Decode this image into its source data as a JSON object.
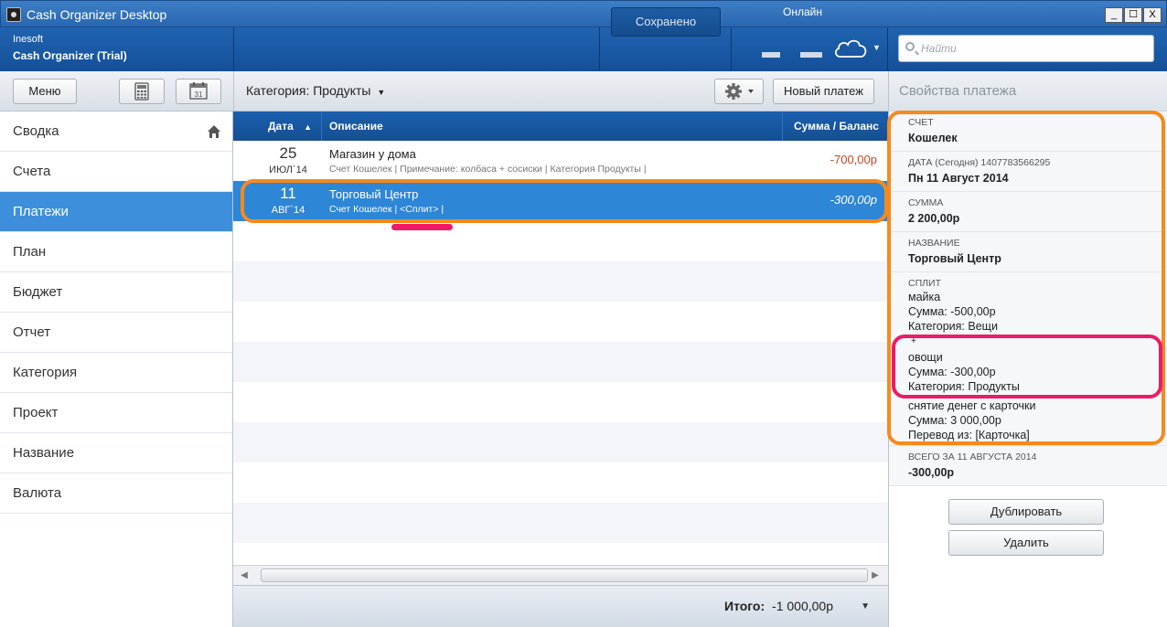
{
  "window": {
    "title": "Cash Organizer Desktop",
    "controls": [
      "_",
      "☐",
      "X"
    ]
  },
  "header": {
    "org": "Inesoft",
    "app": "Cash Organizer (Trial)",
    "saved_label": "Сохранено",
    "online_label": "Онлайн",
    "search_placeholder": "Найти"
  },
  "toolbar": {
    "menu_label": "Меню",
    "category_filter": "Категория: Продукты",
    "new_payment_label": "Новый платеж",
    "props_title": "Свойства платежа"
  },
  "sidebar": {
    "items": [
      {
        "label": "Сводка"
      },
      {
        "label": "Счета"
      },
      {
        "label": "Платежи",
        "active": true
      },
      {
        "label": "План"
      },
      {
        "label": "Бюджет"
      },
      {
        "label": "Отчет"
      },
      {
        "label": "Категория"
      },
      {
        "label": "Проект"
      },
      {
        "label": "Название"
      },
      {
        "label": "Валюта"
      }
    ]
  },
  "table": {
    "columns": {
      "date": "Дата",
      "sort_arrow": "▲",
      "description": "Описание",
      "amount": "Сумма / Баланс"
    },
    "rows": [
      {
        "day": "25",
        "month": "ИЮЛ`14",
        "title": "Магазин у дома",
        "details": "Счет Кошелек | Примечание: колбаса + сосиски | Категория Продукты |",
        "amount": "-700,00р"
      },
      {
        "day": "11",
        "month": "АВГ`14",
        "title": "Торговый Центр",
        "details": "Счет Кошелек | <Сплит> |",
        "amount": "-300,00р",
        "selected": true
      }
    ]
  },
  "footer": {
    "total_label": "Итого:",
    "total_value": "-1 000,00р"
  },
  "properties": {
    "account_label": "СЧЕТ",
    "account_value": "Кошелек",
    "date_label": "ДАТА (Сегодня) 1407783566295",
    "date_value": "Пн 11 Август 2014",
    "sum_label": "СУММА",
    "sum_value": "2 200,00р",
    "name_label": "НАЗВАНИЕ",
    "name_value": "Торговый Центр",
    "split_label": "СПЛИТ",
    "split_lines": [
      "майка",
      "Сумма: -500,00р",
      "Категория: Вещи",
      "+",
      "овощи",
      "Сумма: -300,00р",
      "Категория: Продукты",
      "снятие  денег с карточки",
      "Сумма: 3 000,00р",
      "Перевод из: [Карточка]"
    ],
    "total_day_label": "ВСЕГО ЗА 11 АВГУСТА 2014",
    "total_day_value": "-300,00р",
    "duplicate_label": "Дублировать",
    "delete_label": "Удалить"
  },
  "colors": {
    "accent": "#2e86d6",
    "header": "#1b5fae",
    "highlight_orange": "#f78a1c",
    "highlight_pink": "#ef1a67",
    "negative_amount": "#c0471d"
  }
}
